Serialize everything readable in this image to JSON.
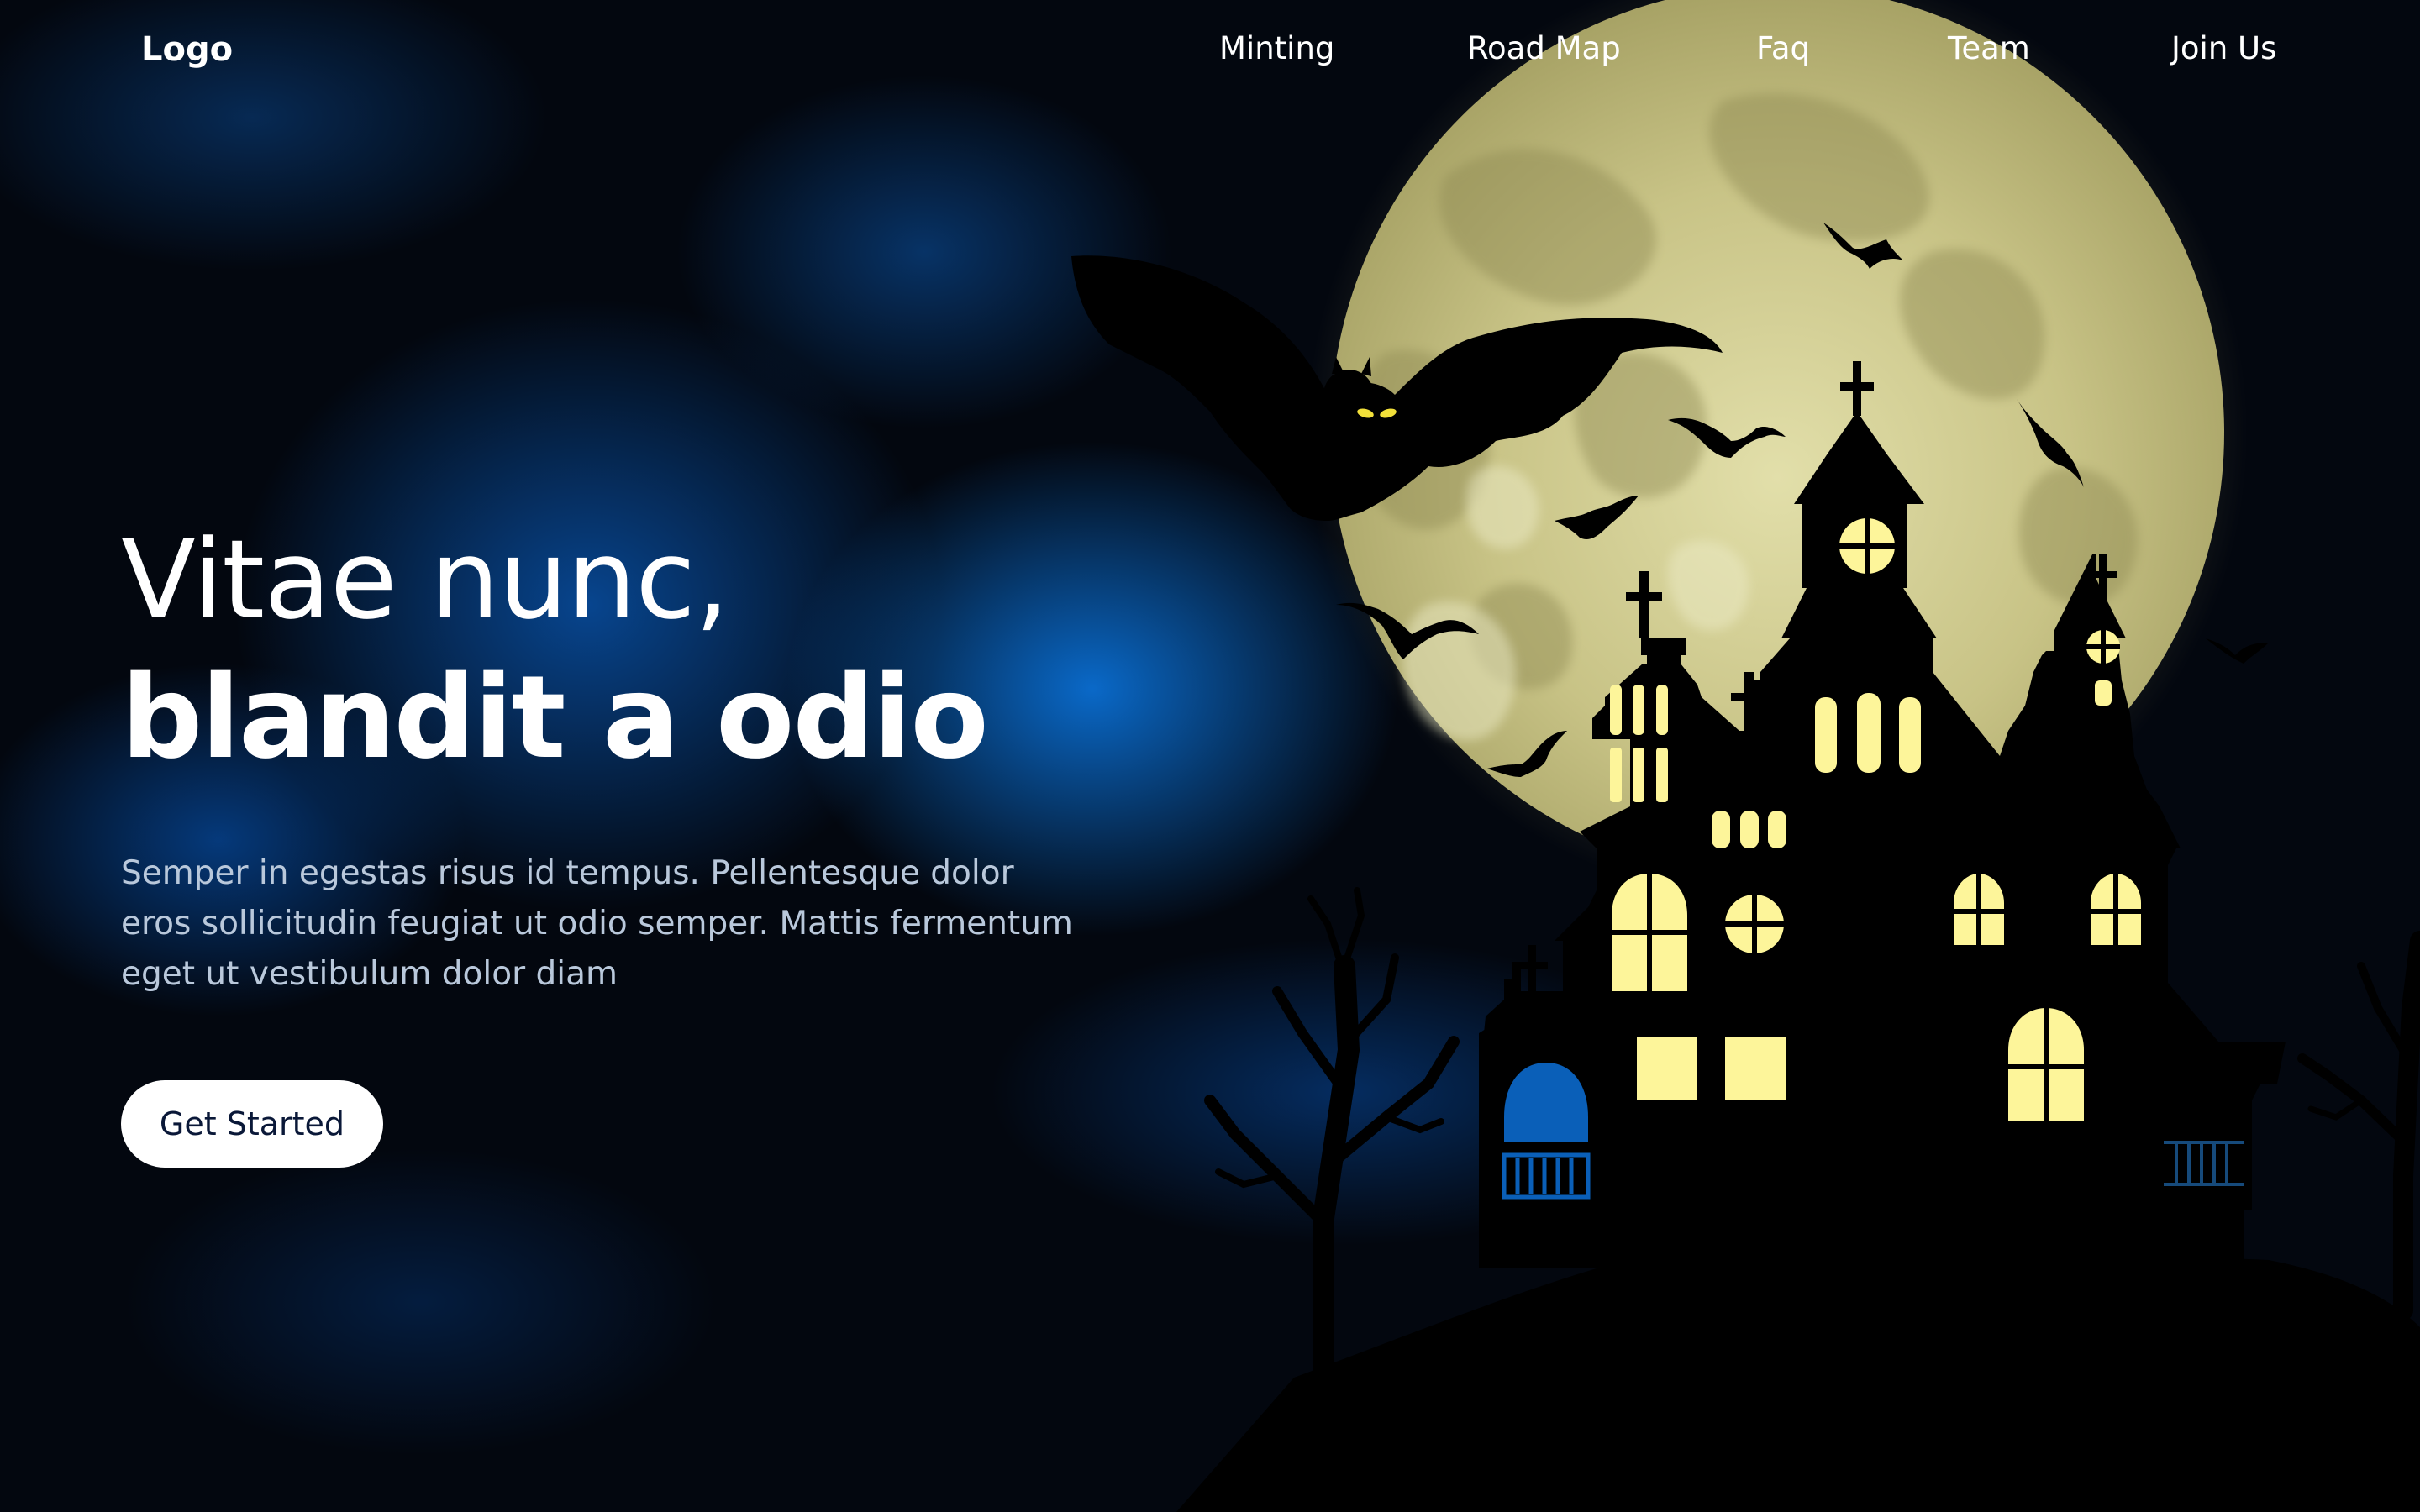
{
  "nav": {
    "logo": "Logo",
    "items": [
      {
        "label": "Minting"
      },
      {
        "label": "Road Map"
      },
      {
        "label": "Faq"
      },
      {
        "label": "Team"
      },
      {
        "label": "Join Us"
      }
    ]
  },
  "hero": {
    "title_line1": "Vitae nunc,",
    "title_line2": "blandit a odio",
    "description": "Semper in egestas risus id tempus. Pellentesque dolor eros sollicitudin feugiat ut odio semper. Mattis fermentum eget ut vestibulum dolor diam",
    "cta_label": "Get Started"
  },
  "illustration": {
    "subject": "haunted-house-full-moon-bats",
    "colors": {
      "moon": "#c9c48a",
      "window_glow": "#fdf59a",
      "silhouette": "#000000",
      "sky_blue": "#0a6ed2"
    }
  }
}
